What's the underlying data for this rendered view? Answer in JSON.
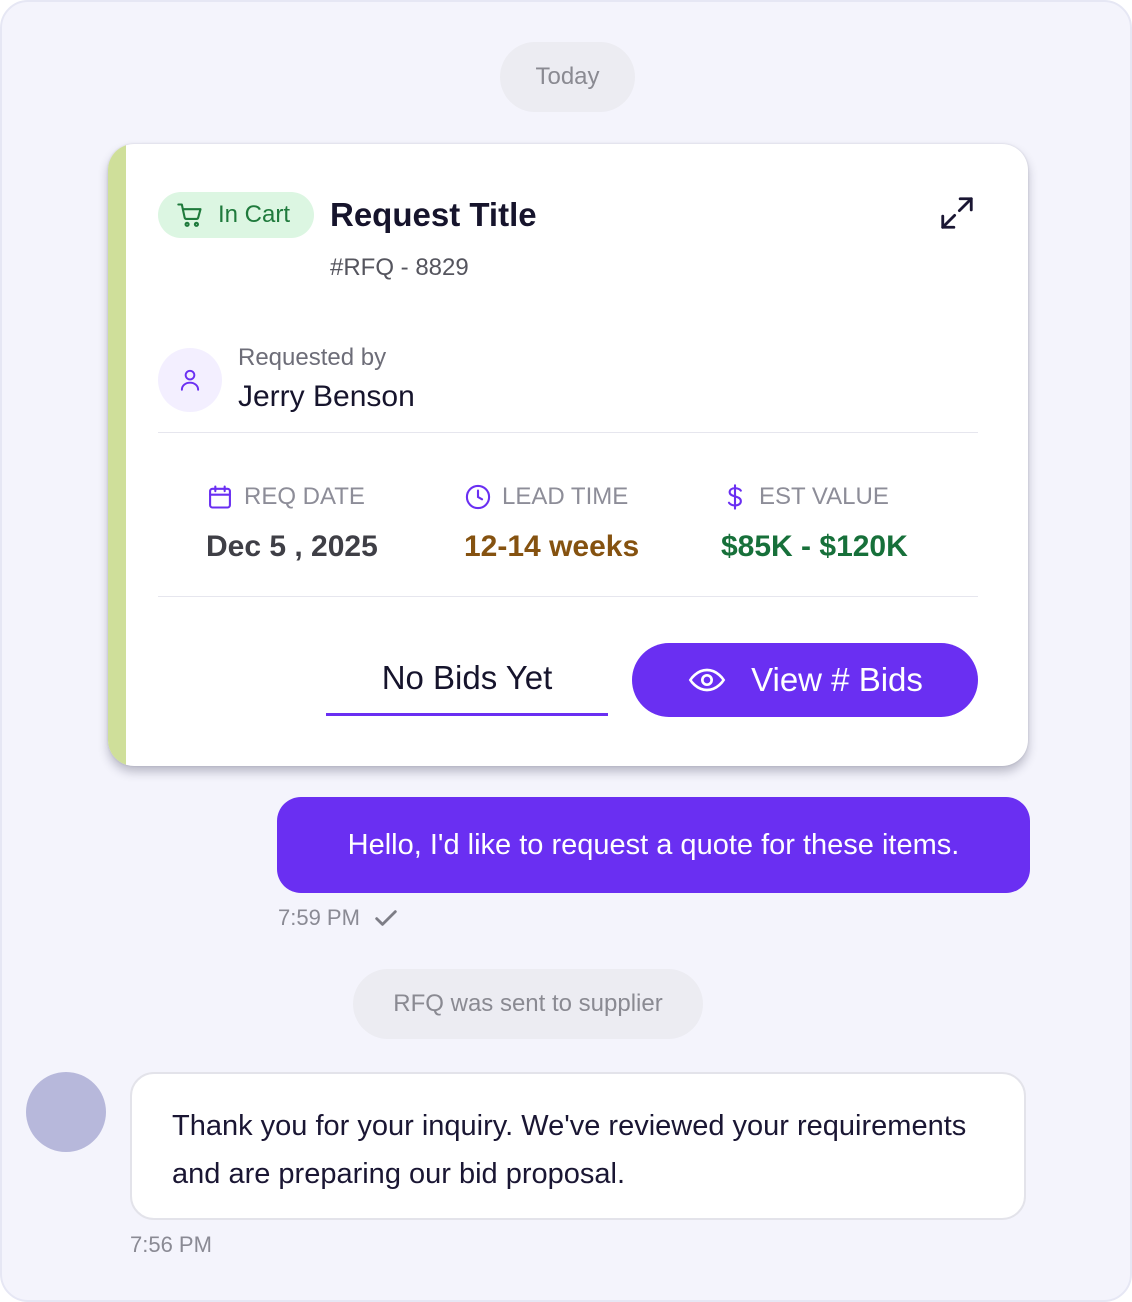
{
  "chat": {
    "date_separator": "Today",
    "rfq_card": {
      "status": "In Cart",
      "title": "Request Title",
      "rfq_id": "#RFQ - 8829",
      "requested_by_label": "Requested by",
      "requester_name": "Jerry Benson",
      "stats": [
        {
          "label": "REQ DATE",
          "value": "Dec 5 , 2025",
          "icon": "calendar-icon",
          "color": "#3f3f46"
        },
        {
          "label": "LEAD TIME",
          "value": "12-14 weeks",
          "icon": "clock-icon",
          "color": "#855210"
        },
        {
          "label": "EST VALUE",
          "value": "$85K - $120K",
          "icon": "dollar-icon",
          "color": "#17703a"
        }
      ],
      "no_bids_label": "No Bids Yet",
      "view_bids_label": "View # Bids",
      "accent_color": "#cfdf9a",
      "primary_color": "#6a2ff2"
    },
    "outgoing_message": {
      "text": "Hello, I'd like to request a quote for these items.",
      "time": "7:59 PM",
      "status_icon": "check-icon"
    },
    "system_message": "RFQ was sent to supplier",
    "incoming_message": {
      "text": "Thank you for your inquiry. We've reviewed your requirements and are preparing our bid proposal.",
      "time": "7:56 PM"
    }
  }
}
